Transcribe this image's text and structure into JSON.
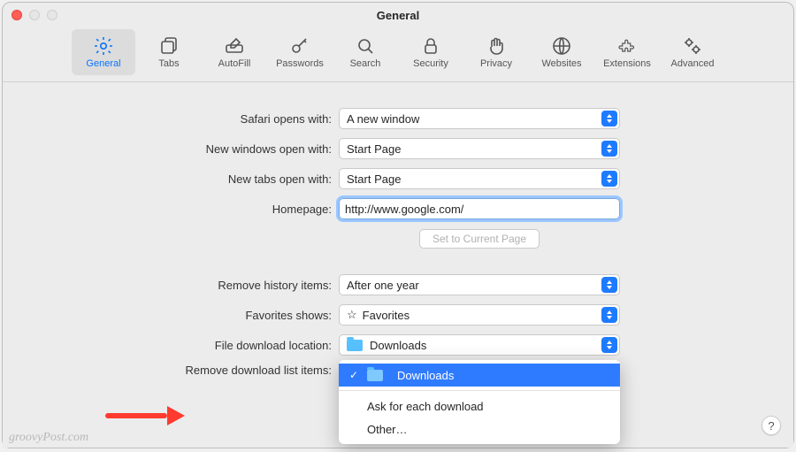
{
  "window": {
    "title": "General"
  },
  "tabs": [
    {
      "label": "General"
    },
    {
      "label": "Tabs"
    },
    {
      "label": "AutoFill"
    },
    {
      "label": "Passwords"
    },
    {
      "label": "Search"
    },
    {
      "label": "Security"
    },
    {
      "label": "Privacy"
    },
    {
      "label": "Websites"
    },
    {
      "label": "Extensions"
    },
    {
      "label": "Advanced"
    }
  ],
  "form": {
    "safari_opens_label": "Safari opens with:",
    "safari_opens_value": "A new window",
    "new_windows_label": "New windows open with:",
    "new_windows_value": "Start Page",
    "new_tabs_label": "New tabs open with:",
    "new_tabs_value": "Start Page",
    "homepage_label": "Homepage:",
    "homepage_value": "http://www.google.com/",
    "set_current_btn": "Set to Current Page",
    "remove_history_label": "Remove history items:",
    "remove_history_value": "After one year",
    "favorites_label": "Favorites shows:",
    "favorites_value": "Favorites",
    "download_loc_label": "File download location:",
    "download_loc_value": "Downloads",
    "remove_dl_label": "Remove download list items:"
  },
  "download_menu": {
    "item_downloads": "Downloads",
    "item_ask": "Ask for each download",
    "item_other": "Other…"
  },
  "watermark": "groovyPost.com",
  "help": "?"
}
